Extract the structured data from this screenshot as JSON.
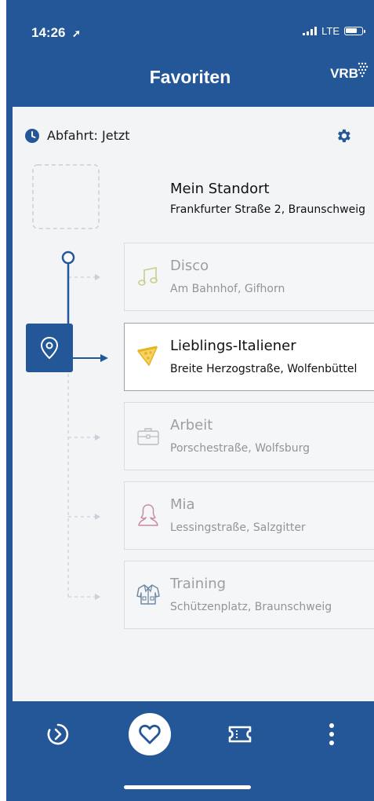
{
  "status_bar": {
    "time": "14:26",
    "network": "LTE"
  },
  "header": {
    "title": "Favoriten",
    "logo_text": "VRB"
  },
  "departure": {
    "label": "Abfahrt: Jetzt"
  },
  "current_location": {
    "name": "Mein Standort",
    "address": "Frankfurter Straße 2, Braunschweig"
  },
  "favorites": [
    {
      "name": "Disco",
      "address": "Am Bahnhof, Gifhorn",
      "icon": "music-note-icon",
      "color": "#c8cf8a"
    },
    {
      "name": "Lieblings-Italiener",
      "address": "Breite Herzogstraße, Wolfenbüttel",
      "icon": "pizza-icon",
      "color": "#e8b520",
      "active": true
    },
    {
      "name": "Arbeit",
      "address": "Porschestraße, Wolfsburg",
      "icon": "briefcase-icon",
      "color": "#b9bcc0"
    },
    {
      "name": "Mia",
      "address": "Lessingstraße, Salzgitter",
      "icon": "person-icon",
      "color": "#c98aa5"
    },
    {
      "name": "Training",
      "address": "Schützenplatz, Braunschweig",
      "icon": "jacket-icon",
      "color": "#6f8aa5"
    }
  ],
  "tabs": [
    {
      "icon": "departure-icon"
    },
    {
      "icon": "heart-icon",
      "active": true
    },
    {
      "icon": "ticket-icon"
    },
    {
      "icon": "more-icon"
    }
  ],
  "colors": {
    "brand": "#245797",
    "background": "#f2f4f6"
  }
}
